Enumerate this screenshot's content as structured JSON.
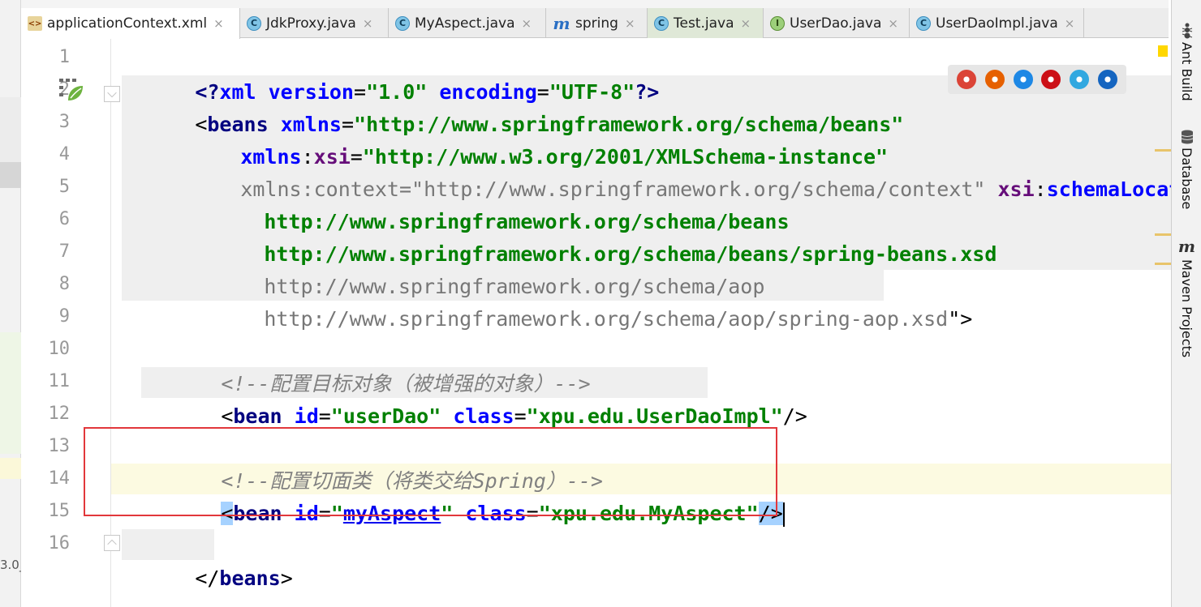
{
  "tabs": [
    {
      "label": "applicationContext.xml",
      "icon": "xml-file-icon",
      "active": true
    },
    {
      "label": "JdkProxy.java",
      "icon": "class-icon",
      "active": false
    },
    {
      "label": "MyAspect.java",
      "icon": "class-icon",
      "active": false
    },
    {
      "label": "spring",
      "icon": "maven-icon",
      "active": false
    },
    {
      "label": "Test.java",
      "icon": "test-class-icon",
      "active": false
    },
    {
      "label": "UserDao.java",
      "icon": "interface-icon",
      "active": false
    },
    {
      "label": "UserDaoImpl.java",
      "icon": "class-icon",
      "active": false
    }
  ],
  "tab_close_glyph": "×",
  "line_numbers": [
    "1",
    "2",
    "3",
    "4",
    "5",
    "6",
    "7",
    "8",
    "9",
    "10",
    "11",
    "12",
    "13",
    "14",
    "15",
    "16"
  ],
  "code": {
    "l1": {
      "a": "<?",
      "b": "xml version",
      "c": "=",
      "d": "\"1.0\"",
      "e": " encoding",
      "f": "=",
      "g": "\"UTF-8\"",
      "h": "?>"
    },
    "l2": {
      "a": "<",
      "b": "beans",
      "c": " xmlns",
      "d": "=",
      "e": "\"http://www.springframework.org/schema/beans\""
    },
    "l3": {
      "a": "xmlns",
      "b": ":",
      "c": "xsi",
      "d": "=",
      "e": "\"http://www.w3.org/2001/XMLSchema-instance\""
    },
    "l4": {
      "a": "xmlns:context=\"http://www.springframework.org/schema/context\"",
      "b": " xsi",
      "c": ":",
      "d": "schemaLocation",
      "e": "=",
      "f": "\""
    },
    "l5": "http://www.springframework.org/schema/beans",
    "l6": "http://www.springframework.org/schema/beans/spring-beans.xsd",
    "l7": "http://www.springframework.org/schema/aop",
    "l8": {
      "a": "http://www.springframework.org/schema/aop/spring-aop.xsd",
      "b": "\">"
    },
    "l10": "<!--配置目标对象（被增强的对象）-->",
    "l11": {
      "a": "<",
      "b": "bean",
      "c": " id",
      "d": "=",
      "e": "\"userDao\"",
      "f": " class",
      "g": "=",
      "h": "\"xpu.edu.UserDaoImpl\"",
      "i": "/>"
    },
    "l13": "<!--配置切面类（将类交给Spring）-->",
    "l14": {
      "a": "<",
      "b": "bean",
      "c": " id",
      "d": "=",
      "e": "\"",
      "f": "myAspect",
      "g": "\"",
      "h": " class",
      "i": "=",
      "j": "\"xpu.edu.MyAspect\"",
      "k": "/>"
    },
    "l16": {
      "a": "</",
      "b": "beans",
      "c": ">"
    }
  },
  "browsers": [
    {
      "name": "chrome-icon",
      "color": "#db4437"
    },
    {
      "name": "firefox-icon",
      "color": "#e66000"
    },
    {
      "name": "safari-icon",
      "color": "#1e88e5"
    },
    {
      "name": "opera-icon",
      "color": "#cc0f16"
    },
    {
      "name": "ie-icon",
      "color": "#31a8e0"
    },
    {
      "name": "edge-icon",
      "color": "#1565c0"
    }
  ],
  "right_tools": [
    {
      "label": "Ant Build",
      "icon": "ant-icon"
    },
    {
      "label": "Database",
      "icon": "database-icon"
    },
    {
      "label": "Maven Projects",
      "icon": "maven-icon",
      "glyph": "m"
    }
  ],
  "left_strip_label": "3.0_",
  "colors": {
    "highlight_box": "#e2373b",
    "current_line": "#fcfae1",
    "selection": "#a6d2ff"
  }
}
